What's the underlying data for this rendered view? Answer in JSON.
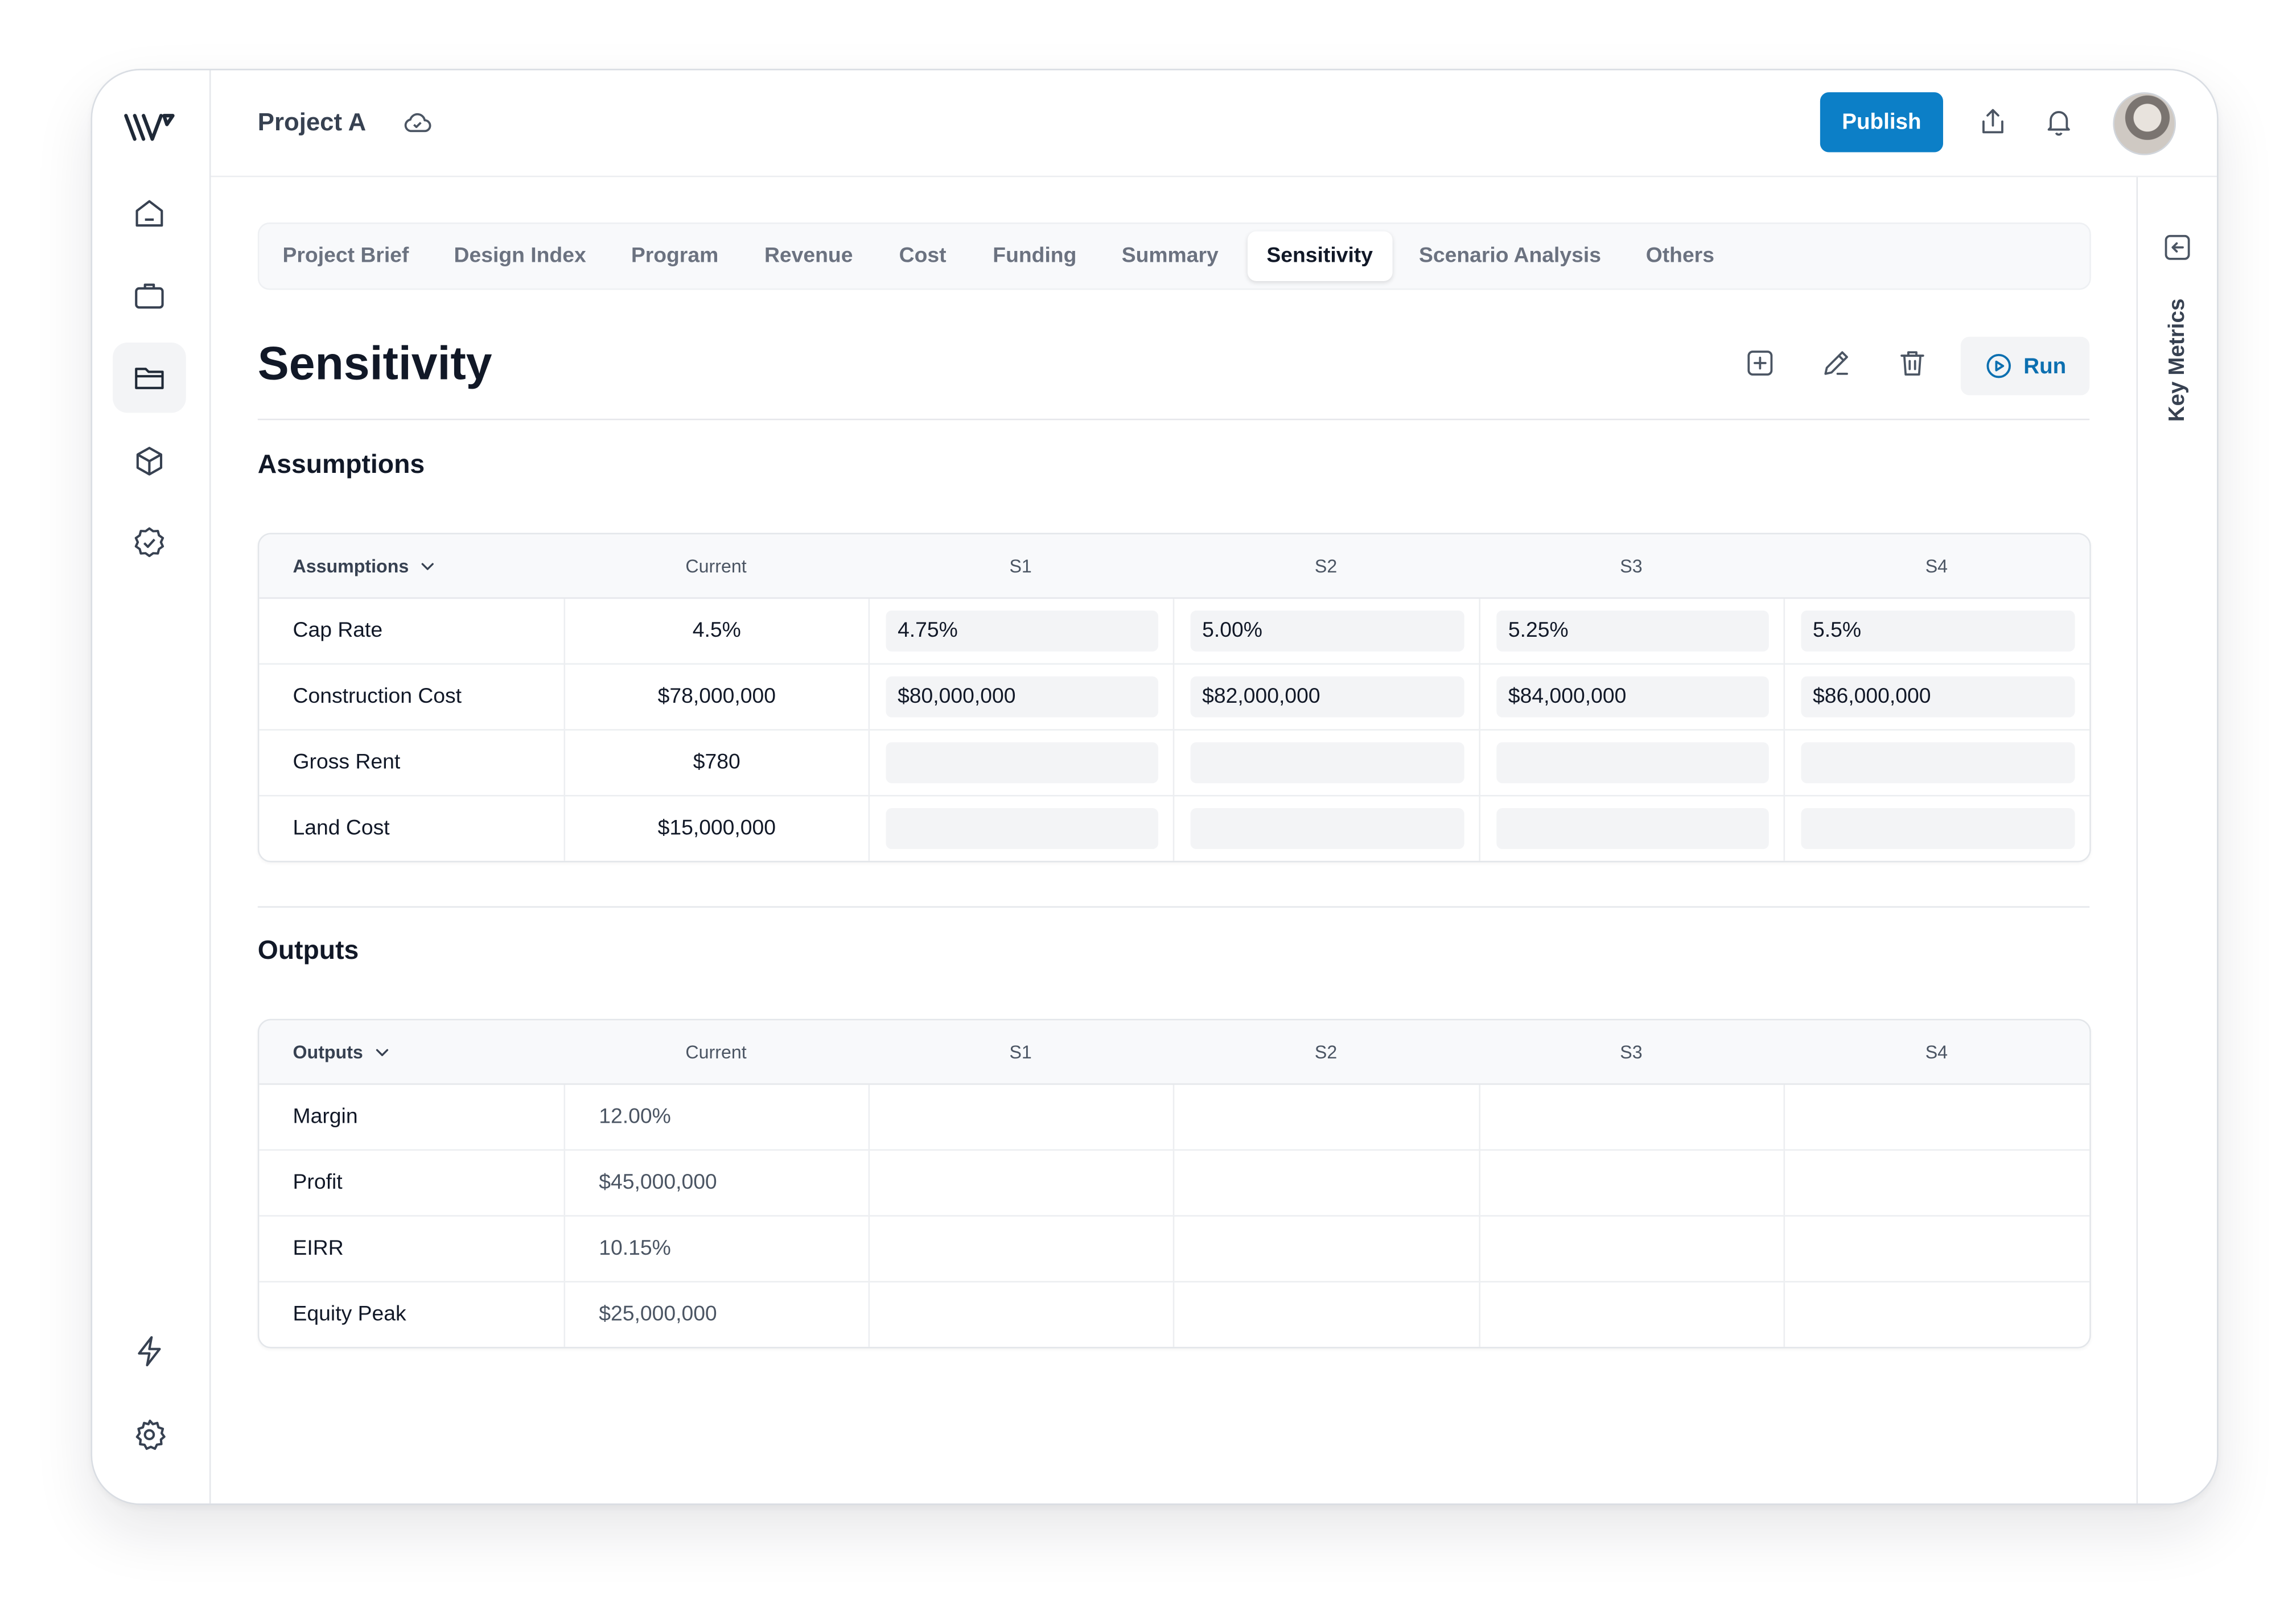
{
  "app": {
    "project_title": "Project A"
  },
  "header": {
    "publish_label": "Publish"
  },
  "right_panel": {
    "label": "Key Metrics"
  },
  "tabs": [
    {
      "label": "Project Brief"
    },
    {
      "label": "Design Index"
    },
    {
      "label": "Program"
    },
    {
      "label": "Revenue"
    },
    {
      "label": "Cost"
    },
    {
      "label": "Funding"
    },
    {
      "label": "Summary"
    },
    {
      "label": "Sensitivity",
      "active": true
    },
    {
      "label": "Scenario Analysis"
    },
    {
      "label": "Others"
    }
  ],
  "page": {
    "title": "Sensitivity",
    "run_label": "Run"
  },
  "assumptions": {
    "section_title": "Assumptions",
    "headers": [
      "Assumptions",
      "Current",
      "S1",
      "S2",
      "S3",
      "S4"
    ],
    "rows": [
      {
        "label": "Cap Rate",
        "current": "4.5%",
        "s1": "4.75%",
        "s2": "5.00%",
        "s3": "5.25%",
        "s4": "5.5%"
      },
      {
        "label": "Construction Cost",
        "current": "$78,000,000",
        "s1": "$80,000,000",
        "s2": "$82,000,000",
        "s3": "$84,000,000",
        "s4": "$86,000,000"
      },
      {
        "label": "Gross Rent",
        "current": "$780",
        "s1": "",
        "s2": "",
        "s3": "",
        "s4": ""
      },
      {
        "label": "Land Cost",
        "current": "$15,000,000",
        "s1": "",
        "s2": "",
        "s3": "",
        "s4": ""
      }
    ]
  },
  "outputs": {
    "section_title": "Outputs",
    "headers": [
      "Outputs",
      "Current",
      "S1",
      "S2",
      "S3",
      "S4"
    ],
    "rows": [
      {
        "label": "Margin",
        "current": "12.00%",
        "s1": "",
        "s2": "",
        "s3": "",
        "s4": ""
      },
      {
        "label": "Profit",
        "current": "$45,000,000",
        "s1": "",
        "s2": "",
        "s3": "",
        "s4": ""
      },
      {
        "label": "EIRR",
        "current": "10.15%",
        "s1": "",
        "s2": "",
        "s3": "",
        "s4": ""
      },
      {
        "label": "Equity Peak",
        "current": "$25,000,000",
        "s1": "",
        "s2": "",
        "s3": "",
        "s4": ""
      }
    ]
  },
  "colors": {
    "accent": "#0c7fc7",
    "run_text": "#0c6fb0"
  },
  "icons": {
    "sidebar": [
      "home-icon",
      "briefcase-icon",
      "folder-icon",
      "cube-icon",
      "badge-check-icon",
      "bolt-icon",
      "gear-icon"
    ],
    "header": [
      "cloud-check-icon",
      "share-icon",
      "bell-icon"
    ],
    "toolbar": [
      "add-square-icon",
      "pencil-icon",
      "trash-icon",
      "play-circle-icon"
    ]
  }
}
